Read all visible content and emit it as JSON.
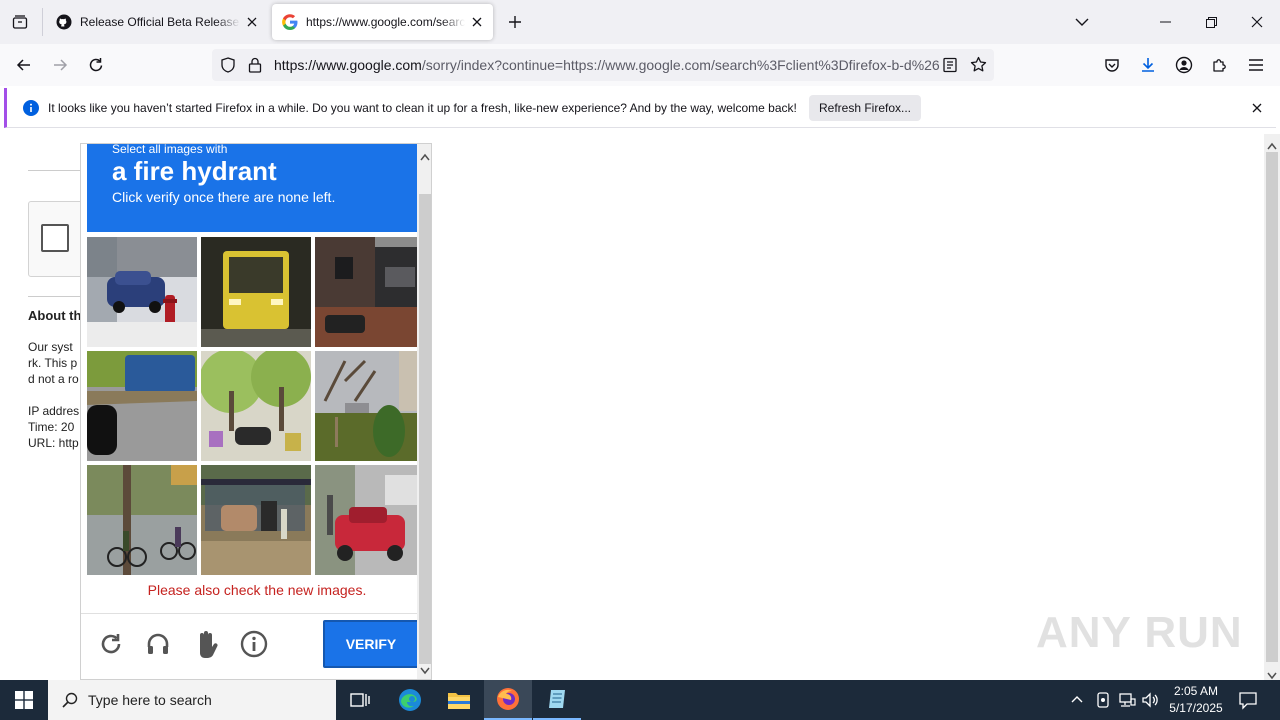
{
  "browser": {
    "tabs": [
      {
        "title": "Release Official Beta Release! · B",
        "favicon": "github-icon",
        "active": false
      },
      {
        "title": "https://www.google.com/search",
        "favicon": "google-icon",
        "active": true
      }
    ],
    "url_domain": "https://www.google.com",
    "url_rest": "/sorry/index?continue=https://www.google.com/search%3Fclient%3Dfirefox-b-d%26"
  },
  "notification": {
    "message": "It looks like you haven’t started Firefox in a while. Do you want to clean it up for a fresh, like-new experience? And by the way, welcome back!",
    "button_label": "Refresh Firefox..."
  },
  "page": {
    "about_heading": "About th",
    "body_lines": [
      "Our syst",
      "rk. This p",
      "d not a ro"
    ],
    "ip_label": "IP addres",
    "time_label": "Time: 20",
    "url_label": "URL: http"
  },
  "captcha": {
    "instruction_sub": "Select all images with",
    "object": "a fire hydrant",
    "hint": "Click verify once there are none left.",
    "error": "Please also check the new images.",
    "verify_label": "VERIFY",
    "tiles": [
      {
        "name": "tile-blue-car-hydrant",
        "palette": [
          "#9aa4b0",
          "#2b3f7a",
          "#e6e6e6",
          "#b01c24"
        ]
      },
      {
        "name": "tile-yellow-bus",
        "palette": [
          "#2a2a22",
          "#d9c232",
          "#5b5a50",
          "#7a6c2a"
        ]
      },
      {
        "name": "tile-brick-house",
        "palette": [
          "#4a3a34",
          "#7a4632",
          "#2d2d2f",
          "#8c8c8c"
        ]
      },
      {
        "name": "tile-coach-highway",
        "palette": [
          "#7c9b3c",
          "#2a5a9a",
          "#9a9a9a",
          "#111111"
        ]
      },
      {
        "name": "tile-trees-scooters",
        "palette": [
          "#9bbf5e",
          "#d8d6c8",
          "#2a2a2a",
          "#c7b24a"
        ]
      },
      {
        "name": "tile-yard-trees",
        "palette": [
          "#b7b9bd",
          "#5b6b2a",
          "#8e7a5c",
          "#3d6a28"
        ]
      },
      {
        "name": "tile-cyclists",
        "palette": [
          "#7b8a5c",
          "#5c4a3a",
          "#9aa0a0",
          "#3a4a2a"
        ]
      },
      {
        "name": "tile-shelter-car",
        "palette": [
          "#5a6a4a",
          "#8a7a5a",
          "#2a2a3a",
          "#b28a6a"
        ]
      },
      {
        "name": "tile-red-car-street",
        "palette": [
          "#b9b9b9",
          "#c8283a",
          "#4a4a4a",
          "#6a7a5a"
        ]
      }
    ]
  },
  "watermark": "ANY RUN",
  "taskbar": {
    "search_placeholder": "Type here to search",
    "time": "2:05 AM",
    "date": "5/17/2025"
  },
  "colors": {
    "captcha_blue": "#1a73e8",
    "error_red": "#c5221f",
    "taskbar": "#1c2a3a"
  }
}
